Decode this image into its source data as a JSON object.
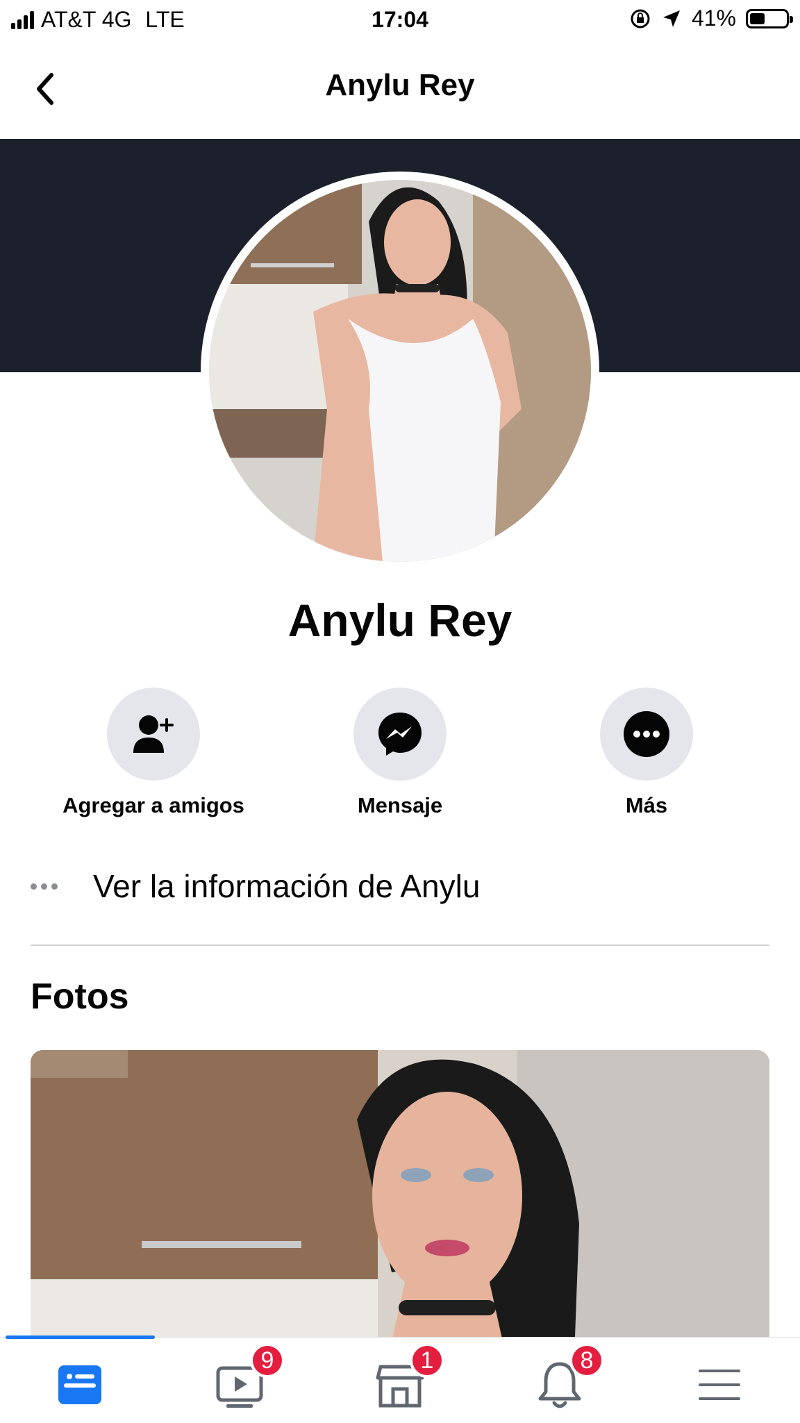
{
  "status_bar": {
    "carrier": "AT&T 4G",
    "network": "LTE",
    "time": "17:04",
    "battery": "41%",
    "battery_level": 0.41
  },
  "nav": {
    "title": "Anylu Rey",
    "back_icon": "chevron-left-icon"
  },
  "profile": {
    "name": "Anylu Rey"
  },
  "actions": [
    {
      "label": "Agregar a amigos",
      "icon": "add-friend-icon"
    },
    {
      "label": "Mensaje",
      "icon": "messenger-icon"
    },
    {
      "label": "Más",
      "icon": "more-icon"
    }
  ],
  "info": {
    "text": "Ver la información de Anylu",
    "icon": "ellipsis-icon"
  },
  "photos": {
    "title": "Fotos"
  },
  "tab_bar": {
    "tabs": [
      {
        "name": "home",
        "icon": "news-feed-icon",
        "badge": ""
      },
      {
        "name": "watch",
        "icon": "video-icon",
        "badge": "9"
      },
      {
        "name": "marketplace",
        "icon": "marketplace-icon",
        "badge": "1"
      },
      {
        "name": "notifications",
        "icon": "bell-icon",
        "badge": "8"
      },
      {
        "name": "menu",
        "icon": "menu-icon",
        "badge": ""
      }
    ]
  },
  "colors": {
    "accent": "#1877f2",
    "cover": "#1b202c",
    "badge": "#e41e3f",
    "action_bg": "#e4e6eb"
  }
}
